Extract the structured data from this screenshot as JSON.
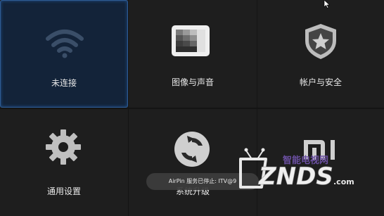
{
  "tiles": {
    "network": {
      "label": "未连接",
      "icon": "wifi-icon"
    },
    "display": {
      "label": "图像与声音",
      "icon": "picture-icon"
    },
    "account": {
      "label": "帐户与安全",
      "icon": "shield-star-icon"
    },
    "general": {
      "label": "通用设置",
      "icon": "gear-icon"
    },
    "update": {
      "label": "系统升级",
      "icon": "refresh-icon"
    },
    "about": {
      "label": "",
      "icon": "mi-logo-icon"
    }
  },
  "toast": {
    "text": "AirPin 服务已停止:  ITV@9"
  },
  "watermark": {
    "brand": "ZNDS",
    "cn": "智能电视网",
    "domain": ".com"
  },
  "colors": {
    "selected_bg": "#132339",
    "selected_border": "#2f5c95",
    "tile_bg": "#1e1e1e"
  }
}
